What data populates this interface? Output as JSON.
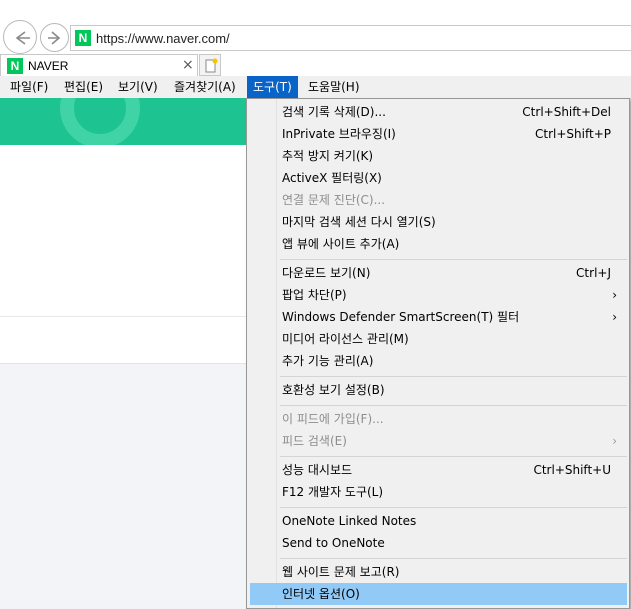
{
  "address": {
    "url": "https://www.naver.com/"
  },
  "tab": {
    "title": "NAVER",
    "close": "×",
    "favicon_letter": "N"
  },
  "menubar": {
    "items": [
      {
        "label": "파일(F)"
      },
      {
        "label": "편집(E)"
      },
      {
        "label": "보기(V)"
      },
      {
        "label": "즐겨찾기(A)"
      },
      {
        "label": "도구(T)"
      },
      {
        "label": "도움말(H)"
      }
    ]
  },
  "tools_menu": {
    "items": [
      {
        "label": "검색 기록 삭제(D)...",
        "shortcut": "Ctrl+Shift+Del"
      },
      {
        "label": "InPrivate 브라우징(I)",
        "shortcut": "Ctrl+Shift+P"
      },
      {
        "label": "추적 방지 켜기(K)",
        "shortcut": ""
      },
      {
        "label": "ActiveX 필터링(X)",
        "shortcut": ""
      },
      {
        "label": "연결 문제 진단(C)...",
        "shortcut": ""
      },
      {
        "label": "마지막 검색 세션 다시 열기(S)",
        "shortcut": ""
      },
      {
        "label": "앱 뷰에 사이트 추가(A)",
        "shortcut": ""
      },
      {
        "label": "다운로드 보기(N)",
        "shortcut": "Ctrl+J"
      },
      {
        "label": "팝업 차단(P)",
        "shortcut": ""
      },
      {
        "label": "Windows Defender SmartScreen(T) 필터",
        "shortcut": ""
      },
      {
        "label": "미디어 라이선스 관리(M)",
        "shortcut": ""
      },
      {
        "label": "추가 기능 관리(A)",
        "shortcut": ""
      },
      {
        "label": "호환성 보기 설정(B)",
        "shortcut": ""
      },
      {
        "label": "이 피드에 가입(F)...",
        "shortcut": ""
      },
      {
        "label": "피드 검색(E)",
        "shortcut": ""
      },
      {
        "label": "성능 대시보드",
        "shortcut": "Ctrl+Shift+U"
      },
      {
        "label": "F12 개발자 도구(L)",
        "shortcut": ""
      },
      {
        "label": "OneNote Linked Notes",
        "shortcut": ""
      },
      {
        "label": "Send to OneNote",
        "shortcut": ""
      },
      {
        "label": "웹 사이트 문제 보고(R)",
        "shortcut": ""
      },
      {
        "label": "인터넷 옵션(O)",
        "shortcut": ""
      }
    ],
    "submenu_arrow": "›"
  },
  "colors": {
    "menu_active": "#0a64c8",
    "item_highlight": "#91c9f7",
    "banner": "#1dc491"
  }
}
